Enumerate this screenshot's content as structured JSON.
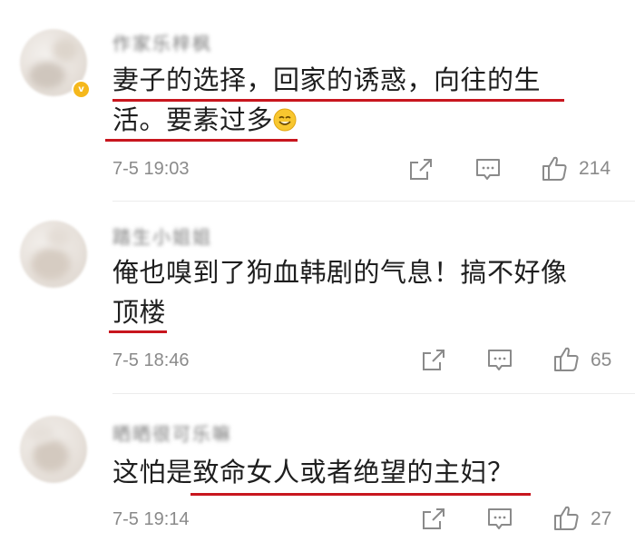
{
  "comments": [
    {
      "username": "作家乐梓枫",
      "verified_badge": "v",
      "text_line1": "妻子的选择，回家的诱惑，向往的生",
      "text_line2": "活。要素过多",
      "emoji": "smile-emoji",
      "time": "7-5 19:03",
      "likes": "214"
    },
    {
      "username": "踏生小姐姐",
      "text_line1": "俺也嗅到了狗血韩剧的气息！搞不好像",
      "text_line2": "顶楼",
      "time": "7-5 18:46",
      "likes": "65"
    },
    {
      "username": "晒晒很可乐嘛",
      "text_line1": "这怕是致命女人或者绝望的主妇？",
      "time": "7-5 19:14",
      "likes": "27"
    }
  ],
  "icons": {
    "share": "share-icon",
    "comment": "comment-icon",
    "like": "thumbs-up-icon"
  },
  "colors": {
    "underline": "#c8161e",
    "meta_text": "#8a8a8a",
    "body_text": "#1e1e1e",
    "badge": "#f5b81c"
  }
}
